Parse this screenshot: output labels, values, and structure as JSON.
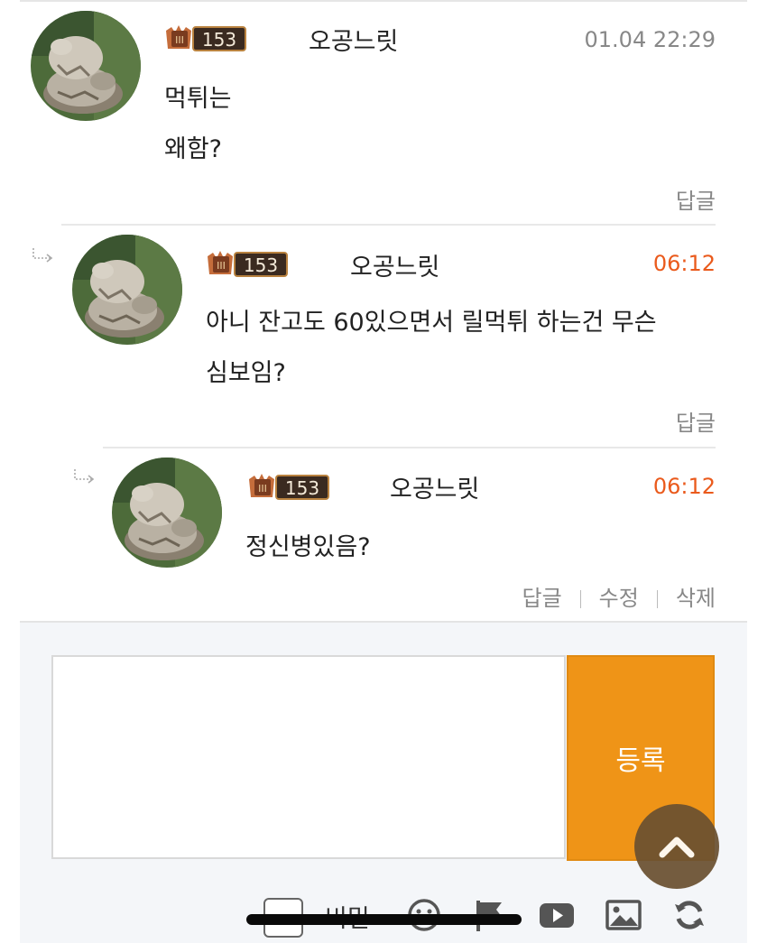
{
  "comments": [
    {
      "level": 0,
      "badge_level": "153",
      "nickname": "오공느릿",
      "time": "01.04 22:29",
      "time_recent": false,
      "lines": [
        "먹튀는",
        "왜함?"
      ],
      "actions": [
        "답글"
      ]
    },
    {
      "level": 1,
      "badge_level": "153",
      "nickname": "오공느릿",
      "time": "06:12",
      "time_recent": true,
      "lines": [
        "아니 잔고도 60있으면서 릴먹튀 하는건 무슨",
        "심보임?"
      ],
      "actions": [
        "답글"
      ]
    },
    {
      "level": 2,
      "badge_level": "153",
      "nickname": "오공느릿",
      "time": "06:12",
      "time_recent": true,
      "lines": [
        "정신병있음?"
      ],
      "actions": [
        "답글",
        "수정",
        "삭제"
      ]
    }
  ],
  "composer": {
    "placeholder": "",
    "submit_label": "등록",
    "secret_label": "비밀"
  },
  "colors": {
    "accent": "#ef9417",
    "recent_time": "#ea5a1c",
    "scroll_top_bg": "#6a5030"
  },
  "icons": [
    "chevron-up-icon",
    "emoji-icon",
    "flag-icon",
    "youtube-icon",
    "image-icon",
    "refresh-icon"
  ]
}
